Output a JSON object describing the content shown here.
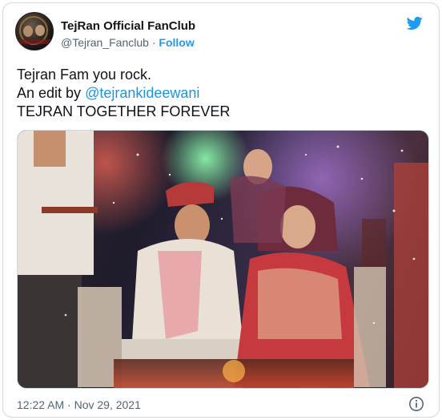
{
  "tweet": {
    "display_name": "TejRan Official FanClub",
    "handle": "@Tejran_Fanclub",
    "separator": "·",
    "follow_label": "Follow",
    "text_lines": [
      "Tejran Fam you rock.",
      "An edit by ",
      "TEJRAN TOGETHER FOREVER"
    ],
    "mention": "@tejrankideewani",
    "timestamp": "12:22 AM · Nov 29, 2021"
  },
  "icons": {
    "brand": "twitter-bird-icon",
    "info": "info-icon"
  },
  "colors": {
    "link": "#1d9bf0",
    "secondary_text": "#536471",
    "border": "#cfd9de"
  }
}
